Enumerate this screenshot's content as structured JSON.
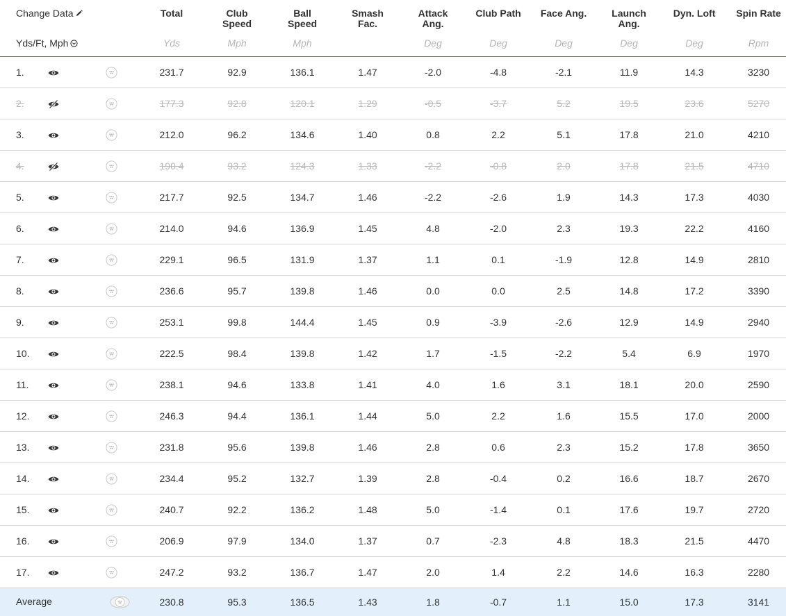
{
  "header": {
    "change_data_label": "Change Data",
    "units_label": "Yds/Ft, Mph",
    "columns": [
      {
        "title_line1": "Total",
        "title_line2": "",
        "unit": "Yds"
      },
      {
        "title_line1": "Club",
        "title_line2": "Speed",
        "unit": "Mph"
      },
      {
        "title_line1": "Ball",
        "title_line2": "Speed",
        "unit": "Mph"
      },
      {
        "title_line1": "Smash",
        "title_line2": "Fac.",
        "unit": ""
      },
      {
        "title_line1": "Attack",
        "title_line2": "Ang.",
        "unit": "Deg"
      },
      {
        "title_line1": "Club Path",
        "title_line2": "",
        "unit": "Deg"
      },
      {
        "title_line1": "Face Ang.",
        "title_line2": "",
        "unit": "Deg"
      },
      {
        "title_line1": "Launch",
        "title_line2": "Ang.",
        "unit": "Deg"
      },
      {
        "title_line1": "Dyn. Loft",
        "title_line2": "",
        "unit": "Deg"
      },
      {
        "title_line1": "Spin Rate",
        "title_line2": "",
        "unit": "Rpm"
      }
    ]
  },
  "rows": [
    {
      "num": "1.",
      "hidden": false,
      "values": [
        "231.7",
        "92.9",
        "136.1",
        "1.47",
        "-2.0",
        "-4.8",
        "-2.1",
        "11.9",
        "14.3",
        "3230"
      ]
    },
    {
      "num": "2.",
      "hidden": true,
      "values": [
        "177.3",
        "92.8",
        "120.1",
        "1.29",
        "-0.5",
        "-3.7",
        "5.2",
        "19.5",
        "23.6",
        "5270"
      ]
    },
    {
      "num": "3.",
      "hidden": false,
      "values": [
        "212.0",
        "96.2",
        "134.6",
        "1.40",
        "0.8",
        "2.2",
        "5.1",
        "17.8",
        "21.0",
        "4210"
      ]
    },
    {
      "num": "4.",
      "hidden": true,
      "values": [
        "190.4",
        "93.2",
        "124.3",
        "1.33",
        "-2.2",
        "-0.8",
        "2.0",
        "17.8",
        "21.5",
        "4710"
      ]
    },
    {
      "num": "5.",
      "hidden": false,
      "values": [
        "217.7",
        "92.5",
        "134.7",
        "1.46",
        "-2.2",
        "-2.6",
        "1.9",
        "14.3",
        "17.3",
        "4030"
      ]
    },
    {
      "num": "6.",
      "hidden": false,
      "values": [
        "214.0",
        "94.6",
        "136.9",
        "1.45",
        "4.8",
        "-2.0",
        "2.3",
        "19.3",
        "22.2",
        "4160"
      ]
    },
    {
      "num": "7.",
      "hidden": false,
      "values": [
        "229.1",
        "96.5",
        "131.9",
        "1.37",
        "1.1",
        "0.1",
        "-1.9",
        "12.8",
        "14.9",
        "2810"
      ]
    },
    {
      "num": "8.",
      "hidden": false,
      "values": [
        "236.6",
        "95.7",
        "139.8",
        "1.46",
        "0.0",
        "0.0",
        "2.5",
        "14.8",
        "17.2",
        "3390"
      ]
    },
    {
      "num": "9.",
      "hidden": false,
      "values": [
        "253.1",
        "99.8",
        "144.4",
        "1.45",
        "0.9",
        "-3.9",
        "-2.6",
        "12.9",
        "14.9",
        "2940"
      ]
    },
    {
      "num": "10.",
      "hidden": false,
      "values": [
        "222.5",
        "98.4",
        "139.8",
        "1.42",
        "1.7",
        "-1.5",
        "-2.2",
        "5.4",
        "6.9",
        "1970"
      ]
    },
    {
      "num": "11.",
      "hidden": false,
      "values": [
        "238.1",
        "94.6",
        "133.8",
        "1.41",
        "4.0",
        "1.6",
        "3.1",
        "18.1",
        "20.0",
        "2590"
      ]
    },
    {
      "num": "12.",
      "hidden": false,
      "values": [
        "246.3",
        "94.4",
        "136.1",
        "1.44",
        "5.0",
        "2.2",
        "1.6",
        "15.5",
        "17.0",
        "2000"
      ]
    },
    {
      "num": "13.",
      "hidden": false,
      "values": [
        "231.8",
        "95.6",
        "139.8",
        "1.46",
        "2.8",
        "0.6",
        "2.3",
        "15.2",
        "17.8",
        "3650"
      ]
    },
    {
      "num": "14.",
      "hidden": false,
      "values": [
        "234.4",
        "95.2",
        "132.7",
        "1.39",
        "2.8",
        "-0.4",
        "0.2",
        "16.6",
        "18.7",
        "2670"
      ]
    },
    {
      "num": "15.",
      "hidden": false,
      "values": [
        "240.7",
        "92.2",
        "136.2",
        "1.48",
        "5.0",
        "-1.4",
        "0.1",
        "17.6",
        "19.7",
        "2720"
      ]
    },
    {
      "num": "16.",
      "hidden": false,
      "values": [
        "206.9",
        "97.9",
        "134.0",
        "1.37",
        "0.7",
        "-2.3",
        "4.8",
        "18.3",
        "21.5",
        "4470"
      ]
    },
    {
      "num": "17.",
      "hidden": false,
      "values": [
        "247.2",
        "93.2",
        "136.7",
        "1.47",
        "2.0",
        "1.4",
        "2.2",
        "14.6",
        "16.3",
        "2280"
      ]
    }
  ],
  "average": {
    "label": "Average",
    "values": [
      "230.8",
      "95.3",
      "136.5",
      "1.43",
      "1.8",
      "-0.7",
      "1.1",
      "15.0",
      "17.3",
      "3141"
    ]
  },
  "icons": {
    "visible": "eye-icon",
    "hidden": "eye-slash-icon",
    "bubble": "chat-bubble-icon",
    "edit": "pencil-icon",
    "units": "clock-circle-icon"
  },
  "colors": {
    "header_divider": "#2a8c97",
    "average_background": "#e3f0fb",
    "average_border": "#3f8fd0",
    "hidden_text": "#b9b9b9",
    "unit_text": "#b5b5b5"
  }
}
